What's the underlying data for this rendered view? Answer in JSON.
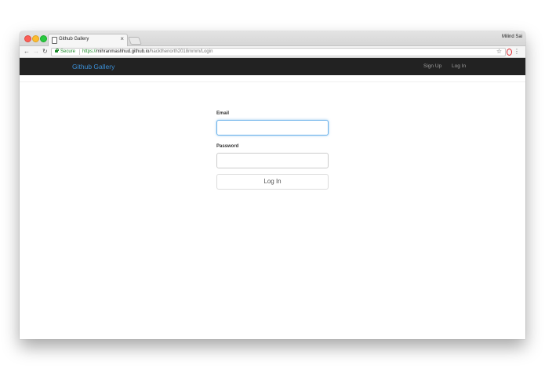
{
  "browser": {
    "tab_title": "Github Gallery",
    "tab_close_glyph": "×",
    "profile_name": "Milind Sai",
    "secure_label": "Secure",
    "url_scheme": "https://",
    "url_host": "mihranmashhud.github.io",
    "url_path": "/hackthenorth2018mmm/Login",
    "icons": {
      "back": "arrow-left-icon",
      "forward": "arrow-right-icon",
      "reload": "reload-icon",
      "lock": "lock-icon",
      "star": "star-icon",
      "opera": "opera-icon",
      "menu": "kebab-menu-icon"
    }
  },
  "navbar": {
    "brand": "Github Gallery",
    "signup": "Sign Up",
    "login": "Log In",
    "background": "#222222",
    "brand_color": "#3b8fd6"
  },
  "form": {
    "email_label": "Email",
    "email_value": "",
    "password_label": "Password",
    "password_value": "",
    "submit_label": "Log In",
    "focus_color": "#66afe9"
  }
}
